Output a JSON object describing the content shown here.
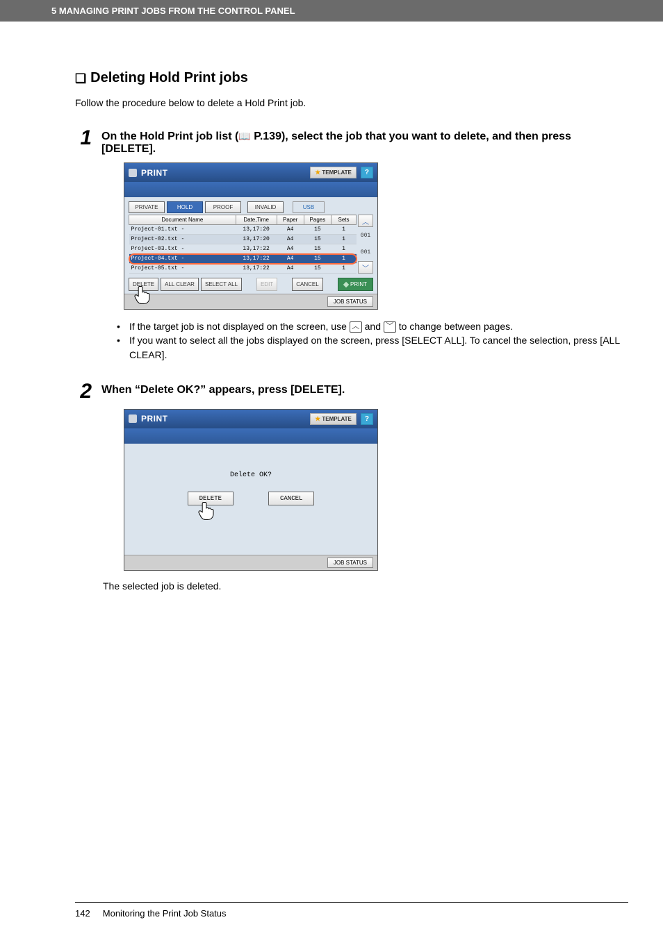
{
  "header": "5 MANAGING PRINT JOBS FROM THE CONTROL PANEL",
  "section_title": "Deleting Hold Print jobs",
  "intro": "Follow the procedure below to delete a Hold Print job.",
  "step1_num": "1",
  "step1_text_a": "On the Hold Print job list (",
  "step1_text_ref": " P.139",
  "step1_text_b": "), select the job that you want to delete, and then press [DELETE].",
  "step2_num": "2",
  "step2_text": "When “Delete OK?” appears, press [DELETE].",
  "panel": {
    "title": "PRINT",
    "template": "TEMPLATE",
    "help": "?",
    "tabs": {
      "private": "PRIVATE",
      "hold": "HOLD",
      "proof": "PROOF",
      "invalid": "INVALID",
      "usb": "USB"
    },
    "cols": {
      "name": "Document Name",
      "dt": "Date,Time",
      "paper": "Paper",
      "pages": "Pages",
      "sets": "Sets"
    },
    "rows": [
      {
        "name": "Project-01.txt -",
        "dt": "13,17:20",
        "paper": "A4",
        "pages": "15",
        "sets": "1",
        "alt": false,
        "sel": false
      },
      {
        "name": "Project-02.txt -",
        "dt": "13,17:20",
        "paper": "A4",
        "pages": "15",
        "sets": "1",
        "alt": true,
        "sel": false
      },
      {
        "name": "Project-03.txt -",
        "dt": "13,17:22",
        "paper": "A4",
        "pages": "15",
        "sets": "1",
        "alt": false,
        "sel": false
      },
      {
        "name": "Project-04.txt -",
        "dt": "13,17:22",
        "paper": "A4",
        "pages": "15",
        "sets": "1",
        "alt": true,
        "sel": true
      },
      {
        "name": "Project-05.txt -",
        "dt": "13,17:22",
        "paper": "A4",
        "pages": "15",
        "sets": "1",
        "alt": false,
        "sel": false
      }
    ],
    "scroll": {
      "page_top": "001",
      "page_bottom": "001"
    },
    "btns": {
      "delete": "DELETE",
      "all_clear": "ALL CLEAR",
      "select_all": "SELECT ALL",
      "edit": "EDIT",
      "cancel": "CANCEL",
      "print": "PRINT"
    },
    "job_status": "JOB STATUS"
  },
  "bullets": {
    "b1a": "If the target job is not displayed on the screen, use ",
    "b1b": " and ",
    "b1c": " to change between pages.",
    "b2": "If you want to select all the jobs displayed on the screen, press [SELECT ALL]. To cancel the selection, press [ALL CLEAR]."
  },
  "panel2": {
    "prompt": "Delete OK?",
    "delete": "DELETE",
    "cancel": "CANCEL"
  },
  "after": "The selected job is deleted.",
  "footer_page": "142",
  "footer_text": "Monitoring the Print Job Status"
}
